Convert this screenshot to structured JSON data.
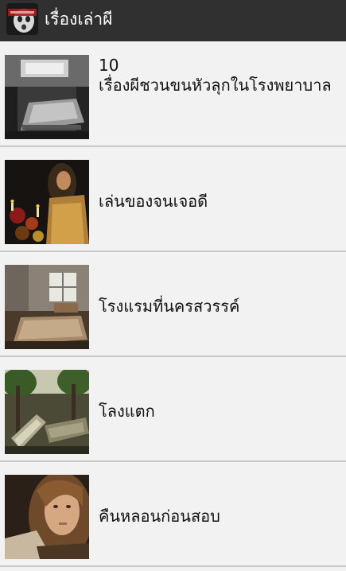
{
  "app": {
    "title": "เรื่องเล่าผี",
    "icon": "ghost-app-icon",
    "colors": {
      "action_bar": "#303030",
      "background": "#f2f2f2",
      "divider": "#c8c8c8"
    }
  },
  "stories": [
    {
      "title": "10\nเรื่องผีชวนขนหัวลุกในโรงพยาบาล",
      "thumbnail": "hospital-ward-photo"
    },
    {
      "title": "เล่นของจนเจอดี",
      "thumbnail": "ritual-candles-photo"
    },
    {
      "title": "โรงแรมที่นครสวรรค์",
      "thumbnail": "abandoned-hotel-room-photo"
    },
    {
      "title": "โลงแตก",
      "thumbnail": "broken-coffins-photo"
    },
    {
      "title": "คืนหลอนก่อนสอบ",
      "thumbnail": "scared-girl-photo"
    }
  ]
}
